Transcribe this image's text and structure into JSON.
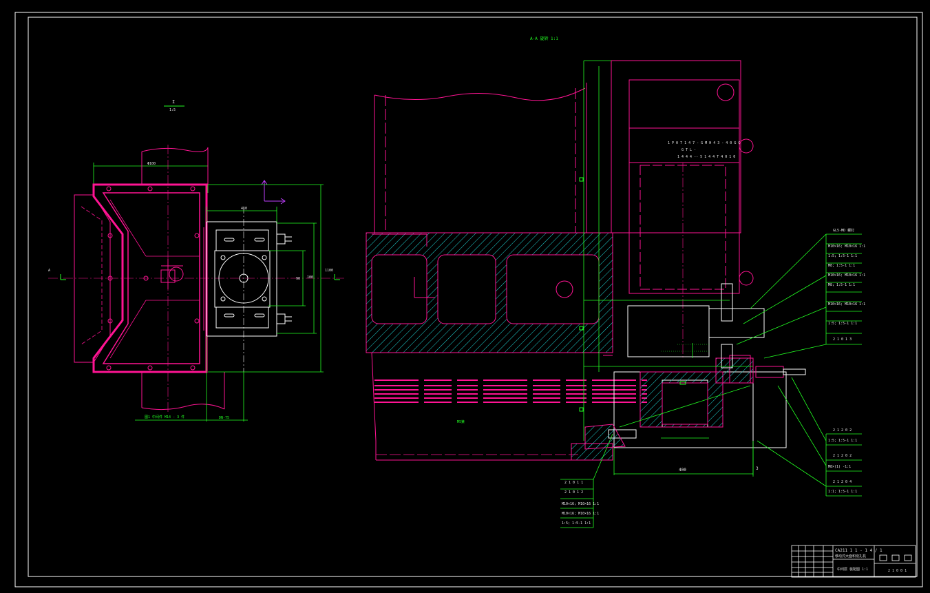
{
  "drawing": {
    "section_title": "A-A 旋转 1:1",
    "view_label": "I",
    "view_scale": "1:5",
    "left_axis_label": "A",
    "callouts_right_top": [
      "GL5-MD 螺钉",
      "M10×16; M10×16 1:1",
      "1:5; 1:5-1 1:1",
      "M8; 1:5-1 1:1",
      "M10×16; M10×16 1:1",
      "M8; 1:5-1 1:1",
      "M10×16; M10×16 1:1",
      "1:5; 1:5-1 1:1",
      "2 1 0 1 3"
    ],
    "callouts_right_bottom": [
      "2 1 2 0 2",
      "1:5; 1:5-1 1:1",
      "2 1 2 0 2",
      "M8×(1) -1:1",
      "2 1 2 0 4",
      "1:1; 1:5-1 1:1"
    ],
    "callouts_left_bottom": [
      "2 1 0 1 1",
      "2 1 0 1 2",
      "M10×16; M10×16 1:1",
      "M10×16; M10×16 1:1",
      "1:5; 1:5-1 1:1"
    ],
    "note_top": [
      "1 P 0 7 1 4 7 - G M H 4 3 - 4 0 G C",
      "G T L -",
      "1 4 4 4 -- 5 1 4 4 T 4 0 1 0"
    ],
    "dimensions": {
      "d400": "400",
      "d3": "3",
      "phi_top": "Φ100",
      "d410": "410",
      "d100": "100",
      "d110": "1100",
      "d90": "90",
      "d75": "DN-75",
      "bottom_left": "图1 中间件 M14 - 3 件",
      "spring": "M5簧"
    },
    "title_block": {
      "drawing_no": "CA211 1 1 - 1 4 / 1",
      "title_line": "移动式大面积绕扎机",
      "subtitle": "中间层 装配图 1:1",
      "sheet": "2 1 0 0 1"
    },
    "colors": {
      "magenta": "#ff1493",
      "green": "#22ff22",
      "cyan": "#20d8d8",
      "white": "#e8e8e8",
      "purple": "#c040ff"
    }
  }
}
